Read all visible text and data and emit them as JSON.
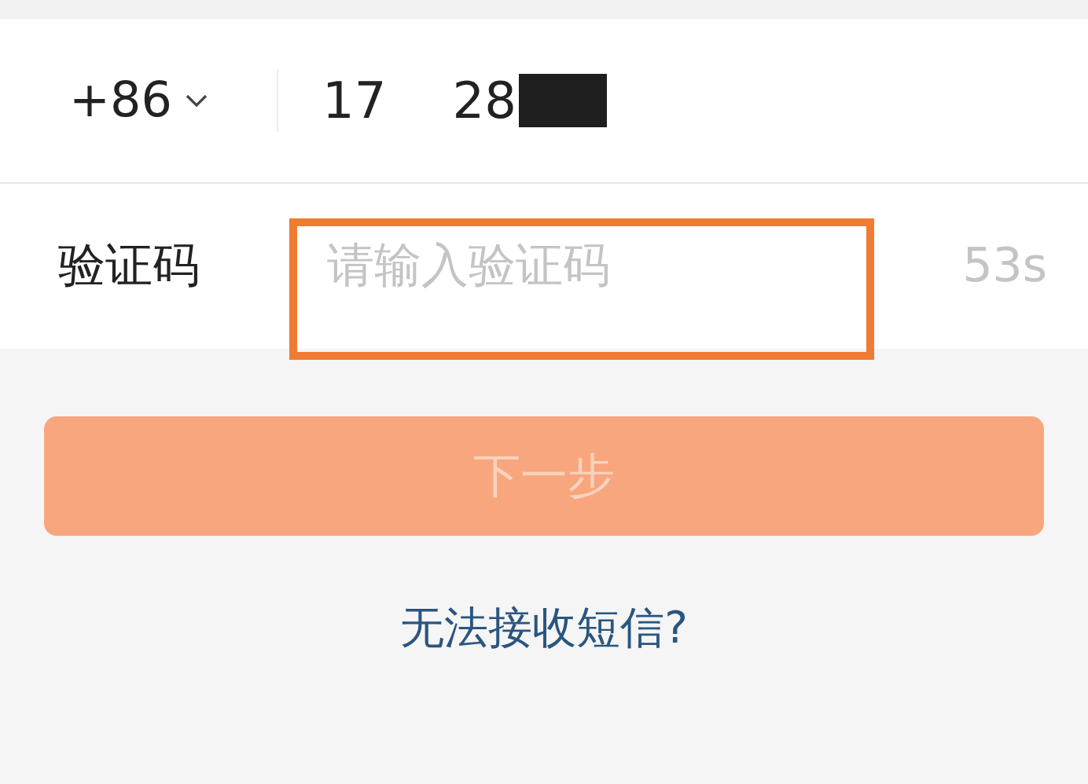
{
  "phone_row": {
    "country_code": "+86",
    "number_parts": [
      "17",
      "28"
    ],
    "redacted": true
  },
  "code_row": {
    "label": "验证码",
    "placeholder": "请输入验证码",
    "countdown": "53s",
    "highlighted": true
  },
  "next_button": {
    "label": "下一步",
    "disabled": true
  },
  "help_link": "无法接收短信?"
}
